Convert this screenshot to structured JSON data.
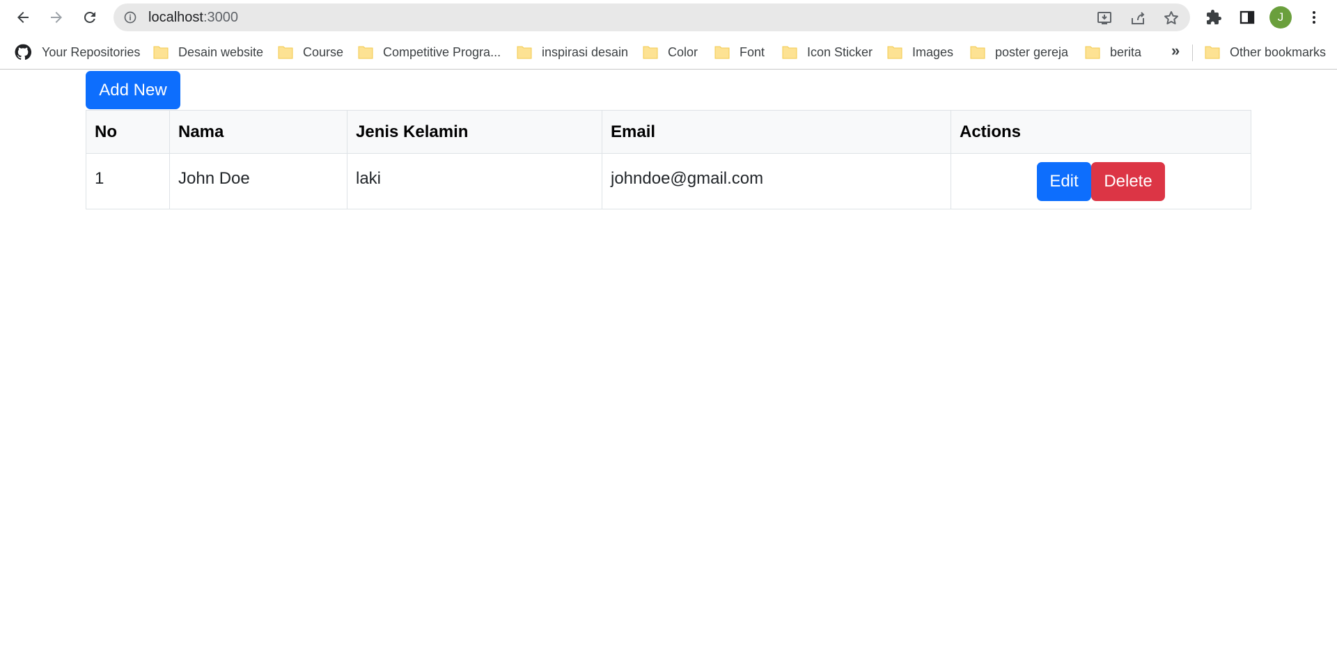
{
  "browser": {
    "url_host": "localhost",
    "url_port": ":3000",
    "profile_initial": "J"
  },
  "bookmarks": {
    "items": [
      {
        "label": "Your Repositories",
        "icon": "github-icon"
      },
      {
        "label": "Desain website",
        "icon": "folder-icon"
      },
      {
        "label": "Course",
        "icon": "folder-icon"
      },
      {
        "label": "Competitive Progra...",
        "icon": "folder-icon"
      },
      {
        "label": "inspirasi desain",
        "icon": "folder-icon"
      },
      {
        "label": "Color",
        "icon": "folder-icon"
      },
      {
        "label": "Font",
        "icon": "folder-icon"
      },
      {
        "label": "Icon Sticker",
        "icon": "folder-icon"
      },
      {
        "label": "Images",
        "icon": "folder-icon"
      },
      {
        "label": "poster gereja",
        "icon": "folder-icon"
      },
      {
        "label": "berita",
        "icon": "folder-icon"
      }
    ],
    "more": "»",
    "other": "Other bookmarks"
  },
  "page": {
    "add_button": "Add New",
    "table": {
      "headers": [
        "No",
        "Nama",
        "Jenis Kelamin",
        "Email",
        "Actions"
      ],
      "rows": [
        {
          "no": "1",
          "nama": "John Doe",
          "jenis_kelamin": "laki",
          "email": "johndoe@gmail.com"
        }
      ],
      "edit_label": "Edit",
      "delete_label": "Delete"
    }
  },
  "colors": {
    "primary": "#0d6efd",
    "danger": "#dc3545",
    "avatar": "#6a9f3c"
  }
}
